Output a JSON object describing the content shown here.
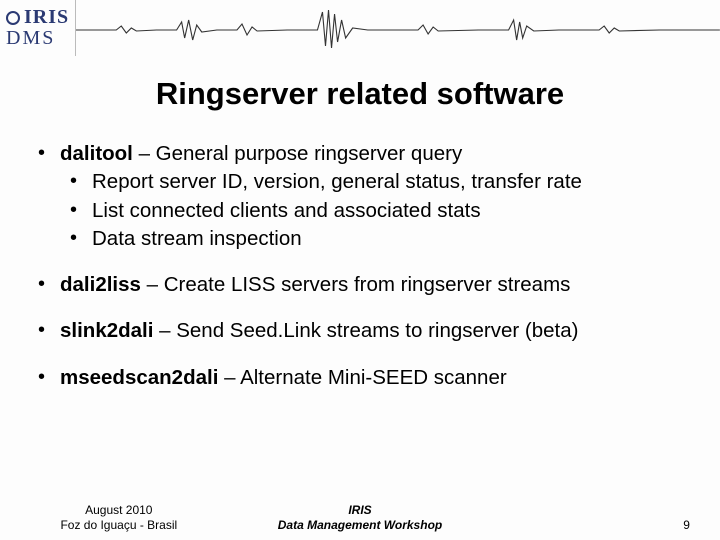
{
  "logo": {
    "line1": "IRIS",
    "line2": "DMS"
  },
  "title": "Ringserver related software",
  "bullets": [
    {
      "term": "dalitool",
      "desc": " – General purpose ringserver query",
      "sub": [
        "Report server ID, version, general status, transfer rate",
        "List connected clients and associated stats",
        "Data stream inspection"
      ]
    },
    {
      "term": "dali2liss",
      "desc": " – Create LISS servers from ringserver streams"
    },
    {
      "term": "slink2dali",
      "desc": " – Send Seed.Link streams to ringserver (beta)"
    },
    {
      "term": "mseedscan2dali",
      "desc": " – Alternate Mini-SEED scanner"
    }
  ],
  "footer": {
    "left_line1": "August 2010",
    "left_line2": "Foz do Iguaçu - Brasil",
    "center_line1": "IRIS",
    "center_line2": "Data Management Workshop",
    "page": "9"
  }
}
